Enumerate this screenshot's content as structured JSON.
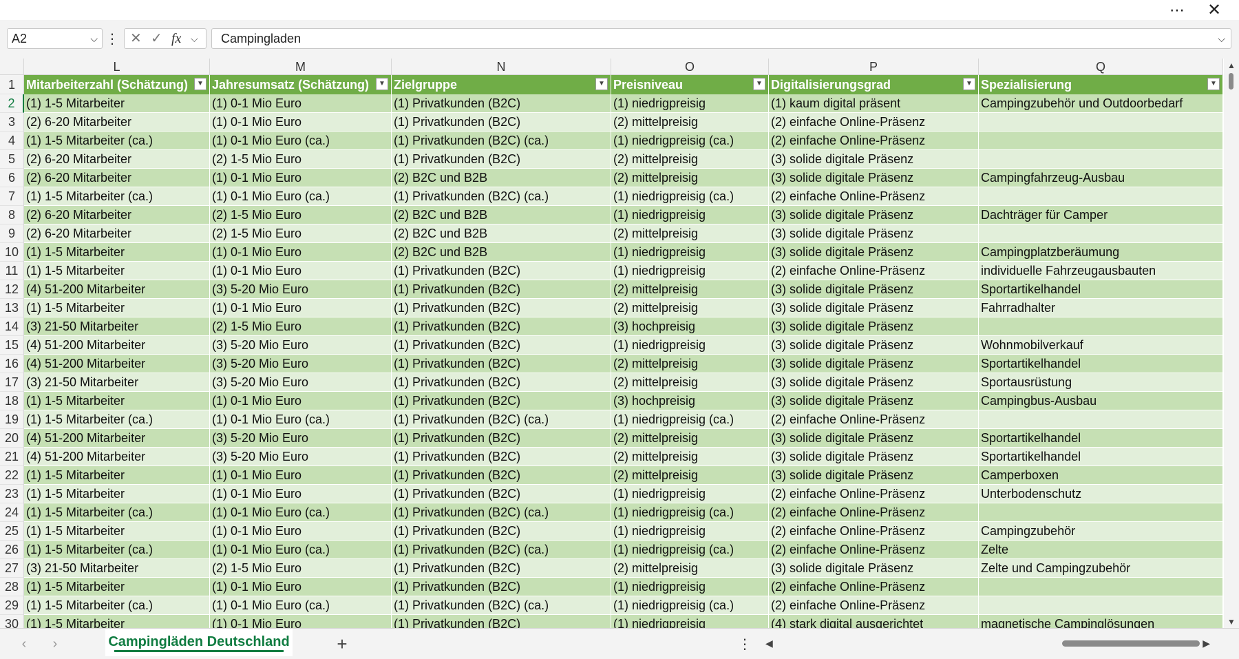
{
  "window": {
    "more_icon": "more-horizontal-icon",
    "close_icon": "close-icon"
  },
  "formula_bar": {
    "name_box": "A2",
    "formula": "Campingladen"
  },
  "columns": [
    {
      "letter": "L",
      "header": "Mitarbeiterzahl (Schätzung)"
    },
    {
      "letter": "M",
      "header": "Jahresumsatz (Schätzung)"
    },
    {
      "letter": "N",
      "header": "Zielgruppe"
    },
    {
      "letter": "O",
      "header": "Preisniveau"
    },
    {
      "letter": "P",
      "header": "Digitalisierungsgrad"
    },
    {
      "letter": "Q",
      "header": "Spezialisierung"
    }
  ],
  "rows": [
    {
      "num": "2",
      "cells": [
        "(1) 1-5 Mitarbeiter",
        "(1) 0-1 Mio Euro",
        "(1) Privatkunden (B2C)",
        "(1) niedrigpreisig",
        "(1) kaum digital präsent",
        "Campingzubehör und Outdoorbedarf"
      ]
    },
    {
      "num": "3",
      "cells": [
        "(2) 6-20 Mitarbeiter",
        "(1) 0-1 Mio Euro",
        "(1) Privatkunden (B2C)",
        "(2) mittelpreisig",
        "(2) einfache Online-Präsenz",
        ""
      ]
    },
    {
      "num": "4",
      "cells": [
        "(1) 1-5 Mitarbeiter (ca.)",
        "(1) 0-1 Mio Euro (ca.)",
        "(1) Privatkunden (B2C) (ca.)",
        "(1) niedrigpreisig (ca.)",
        "(2) einfache Online-Präsenz",
        ""
      ]
    },
    {
      "num": "5",
      "cells": [
        "(2) 6-20 Mitarbeiter",
        "(2) 1-5 Mio Euro",
        "(1) Privatkunden (B2C)",
        "(2) mittelpreisig",
        "(3) solide digitale Präsenz",
        ""
      ]
    },
    {
      "num": "6",
      "cells": [
        "(2) 6-20 Mitarbeiter",
        "(1) 0-1 Mio Euro",
        "(2) B2C und B2B",
        "(2) mittelpreisig",
        "(3) solide digitale Präsenz",
        "Campingfahrzeug-Ausbau"
      ]
    },
    {
      "num": "7",
      "cells": [
        "(1) 1-5 Mitarbeiter (ca.)",
        "(1) 0-1 Mio Euro (ca.)",
        "(1) Privatkunden (B2C) (ca.)",
        "(1) niedrigpreisig (ca.)",
        "(2) einfache Online-Präsenz",
        ""
      ]
    },
    {
      "num": "8",
      "cells": [
        "(2) 6-20 Mitarbeiter",
        "(2) 1-5 Mio Euro",
        "(2) B2C und B2B",
        "(1) niedrigpreisig",
        "(3) solide digitale Präsenz",
        "Dachträger für Camper"
      ]
    },
    {
      "num": "9",
      "cells": [
        "(2) 6-20 Mitarbeiter",
        "(2) 1-5 Mio Euro",
        "(2) B2C und B2B",
        "(2) mittelpreisig",
        "(3) solide digitale Präsenz",
        ""
      ]
    },
    {
      "num": "10",
      "cells": [
        "(1) 1-5 Mitarbeiter",
        "(1) 0-1 Mio Euro",
        "(2) B2C und B2B",
        "(1) niedrigpreisig",
        "(3) solide digitale Präsenz",
        "Campingplatzberäumung"
      ]
    },
    {
      "num": "11",
      "cells": [
        "(1) 1-5 Mitarbeiter",
        "(1) 0-1 Mio Euro",
        "(1) Privatkunden (B2C)",
        "(1) niedrigpreisig",
        "(2) einfache Online-Präsenz",
        "individuelle Fahrzeugausbauten"
      ]
    },
    {
      "num": "12",
      "cells": [
        "(4) 51-200 Mitarbeiter",
        "(3) 5-20 Mio Euro",
        "(1) Privatkunden (B2C)",
        "(2) mittelpreisig",
        "(3) solide digitale Präsenz",
        "Sportartikelhandel"
      ]
    },
    {
      "num": "13",
      "cells": [
        "(1) 1-5 Mitarbeiter",
        "(1) 0-1 Mio Euro",
        "(1) Privatkunden (B2C)",
        "(2) mittelpreisig",
        "(3) solide digitale Präsenz",
        "Fahrradhalter"
      ]
    },
    {
      "num": "14",
      "cells": [
        "(3) 21-50 Mitarbeiter",
        "(2) 1-5 Mio Euro",
        "(1) Privatkunden (B2C)",
        "(3) hochpreisig",
        "(3) solide digitale Präsenz",
        ""
      ]
    },
    {
      "num": "15",
      "cells": [
        "(4) 51-200 Mitarbeiter",
        "(3) 5-20 Mio Euro",
        "(1) Privatkunden (B2C)",
        "(1) niedrigpreisig",
        "(3) solide digitale Präsenz",
        "Wohnmobilverkauf"
      ]
    },
    {
      "num": "16",
      "cells": [
        "(4) 51-200 Mitarbeiter",
        "(3) 5-20 Mio Euro",
        "(1) Privatkunden (B2C)",
        "(2) mittelpreisig",
        "(3) solide digitale Präsenz",
        "Sportartikelhandel"
      ]
    },
    {
      "num": "17",
      "cells": [
        "(3) 21-50 Mitarbeiter",
        "(3) 5-20 Mio Euro",
        "(1) Privatkunden (B2C)",
        "(2) mittelpreisig",
        "(3) solide digitale Präsenz",
        "Sportausrüstung"
      ]
    },
    {
      "num": "18",
      "cells": [
        "(1) 1-5 Mitarbeiter",
        "(1) 0-1 Mio Euro",
        "(1) Privatkunden (B2C)",
        "(3) hochpreisig",
        "(3) solide digitale Präsenz",
        "Campingbus-Ausbau"
      ]
    },
    {
      "num": "19",
      "cells": [
        "(1) 1-5 Mitarbeiter (ca.)",
        "(1) 0-1 Mio Euro (ca.)",
        "(1) Privatkunden (B2C) (ca.)",
        "(1) niedrigpreisig (ca.)",
        "(2) einfache Online-Präsenz",
        ""
      ]
    },
    {
      "num": "20",
      "cells": [
        "(4) 51-200 Mitarbeiter",
        "(3) 5-20 Mio Euro",
        "(1) Privatkunden (B2C)",
        "(2) mittelpreisig",
        "(3) solide digitale Präsenz",
        "Sportartikelhandel"
      ]
    },
    {
      "num": "21",
      "cells": [
        "(4) 51-200 Mitarbeiter",
        "(3) 5-20 Mio Euro",
        "(1) Privatkunden (B2C)",
        "(2) mittelpreisig",
        "(3) solide digitale Präsenz",
        "Sportartikelhandel"
      ]
    },
    {
      "num": "22",
      "cells": [
        "(1) 1-5 Mitarbeiter",
        "(1) 0-1 Mio Euro",
        "(1) Privatkunden (B2C)",
        "(2) mittelpreisig",
        "(3) solide digitale Präsenz",
        "Camperboxen"
      ]
    },
    {
      "num": "23",
      "cells": [
        "(1) 1-5 Mitarbeiter",
        "(1) 0-1 Mio Euro",
        "(1) Privatkunden (B2C)",
        "(1) niedrigpreisig",
        "(2) einfache Online-Präsenz",
        "Unterbodenschutz"
      ]
    },
    {
      "num": "24",
      "cells": [
        "(1) 1-5 Mitarbeiter (ca.)",
        "(1) 0-1 Mio Euro (ca.)",
        "(1) Privatkunden (B2C) (ca.)",
        "(1) niedrigpreisig (ca.)",
        "(2) einfache Online-Präsenz",
        ""
      ]
    },
    {
      "num": "25",
      "cells": [
        "(1) 1-5 Mitarbeiter",
        "(1) 0-1 Mio Euro",
        "(1) Privatkunden (B2C)",
        "(1) niedrigpreisig",
        "(2) einfache Online-Präsenz",
        "Campingzubehör"
      ]
    },
    {
      "num": "26",
      "cells": [
        "(1) 1-5 Mitarbeiter (ca.)",
        "(1) 0-1 Mio Euro (ca.)",
        "(1) Privatkunden (B2C) (ca.)",
        "(1) niedrigpreisig (ca.)",
        "(2) einfache Online-Präsenz",
        "Zelte"
      ]
    },
    {
      "num": "27",
      "cells": [
        "(3) 21-50 Mitarbeiter",
        "(2) 1-5 Mio Euro",
        "(1) Privatkunden (B2C)",
        "(2) mittelpreisig",
        "(3) solide digitale Präsenz",
        "Zelte und Campingzubehör"
      ]
    },
    {
      "num": "28",
      "cells": [
        "(1) 1-5 Mitarbeiter",
        "(1) 0-1 Mio Euro",
        "(1) Privatkunden (B2C)",
        "(1) niedrigpreisig",
        "(2) einfache Online-Präsenz",
        ""
      ]
    },
    {
      "num": "29",
      "cells": [
        "(1) 1-5 Mitarbeiter (ca.)",
        "(1) 0-1 Mio Euro (ca.)",
        "(1) Privatkunden (B2C) (ca.)",
        "(1) niedrigpreisig (ca.)",
        "(2) einfache Online-Präsenz",
        ""
      ]
    },
    {
      "num": "30",
      "cells": [
        "(1) 1-5 Mitarbeiter",
        "(1) 0-1 Mio Euro",
        "(1) Privatkunden (B2C)",
        "(1) niedrigpreisig",
        "(4) stark digital ausgerichtet",
        "magnetische Campinglösungen"
      ]
    }
  ],
  "sheet_tabs": [
    {
      "label": "Campingläden Deutschland",
      "active": true
    }
  ],
  "colors": {
    "header_bg": "#70ad47",
    "band_dark": "#c6e0b4",
    "band_light": "#e2efda",
    "accent": "#107c41"
  }
}
